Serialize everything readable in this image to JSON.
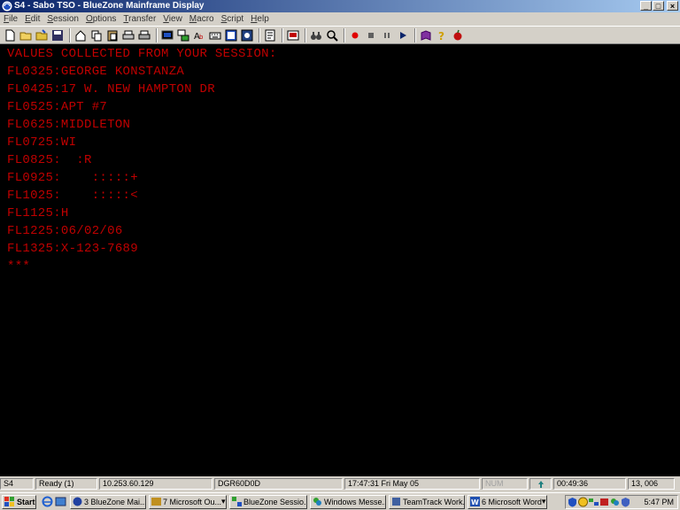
{
  "window": {
    "title": "S4 - Sabo TSO - BlueZone Mainframe Display",
    "buttons": [
      "_",
      "□",
      "×"
    ]
  },
  "menu": [
    {
      "first": "F",
      "rest": "ile"
    },
    {
      "first": "E",
      "rest": "dit"
    },
    {
      "first": "S",
      "rest": "ession"
    },
    {
      "first": "O",
      "rest": "ptions"
    },
    {
      "first": "T",
      "rest": "ransfer"
    },
    {
      "first": "V",
      "rest": "iew"
    },
    {
      "first": "M",
      "rest": "acro"
    },
    {
      "first": "S",
      "rest": "cript"
    },
    {
      "first": "H",
      "rest": "elp"
    }
  ],
  "toolbar": {
    "icons": [
      "new-icon",
      "open-icon",
      "open-folder-icon",
      "save-icon",
      "home-icon",
      "copy-icon",
      "paste-icon",
      "print-icon",
      "print-setup-icon",
      "display-icon",
      "network-icon",
      "font-icon",
      "keyboard-icon",
      "screen-icon",
      "capture-icon",
      "document-icon",
      "terminal-icon",
      "binoculars-icon",
      "find-icon",
      "record-icon",
      "stop-icon",
      "pause-icon",
      "play-icon",
      "book-icon",
      "help-icon",
      "apple-icon"
    ],
    "colors": {
      "record": "#e00000",
      "play": "#0a246a"
    }
  },
  "terminal": {
    "color": "#c00000",
    "lines": [
      "VALUES COLLECTED FROM YOUR SESSION:",
      "FL0325:GEORGE KONSTANZA",
      "FL0425:17 W. NEW HAMPTON DR",
      "FL0525:APT #7",
      "FL0625:MIDDLETON",
      "FL0725:WI",
      "FL0825:  :R",
      "FL0925:    :::::+",
      "FL1025:    :::::<",
      "FL1125:H",
      "FL1225:06/02/06",
      "FL1325:X-123-7689",
      "***"
    ]
  },
  "statusbar": {
    "session": "S4",
    "state": "Ready (1)",
    "ip": "10.253.60.129",
    "lu": "DGR60D0D",
    "datetime": "17:47:31  Fri May 05",
    "num": "NUM",
    "timer": "00:49:36",
    "cursor": "13, 006"
  },
  "taskbar": {
    "start": "Start",
    "tasks": [
      {
        "label": "3 BlueZone Mai...",
        "arrow": "▾",
        "color": "#2040a0"
      },
      {
        "label": "7 Microsoft Ou...",
        "arrow": "▾",
        "color": "#c09020"
      },
      {
        "label": "BlueZone Sessio...",
        "arrow": "",
        "color": "#30a030"
      },
      {
        "label": "Windows Messe...",
        "arrow": "",
        "color": "#2080c0"
      },
      {
        "label": "TeamTrack Work...",
        "arrow": "",
        "color": "#4060a0"
      },
      {
        "label": "6 Microsoft Word",
        "arrow": "▾",
        "color": "#2050b0"
      }
    ],
    "clock": "5:47 PM"
  }
}
